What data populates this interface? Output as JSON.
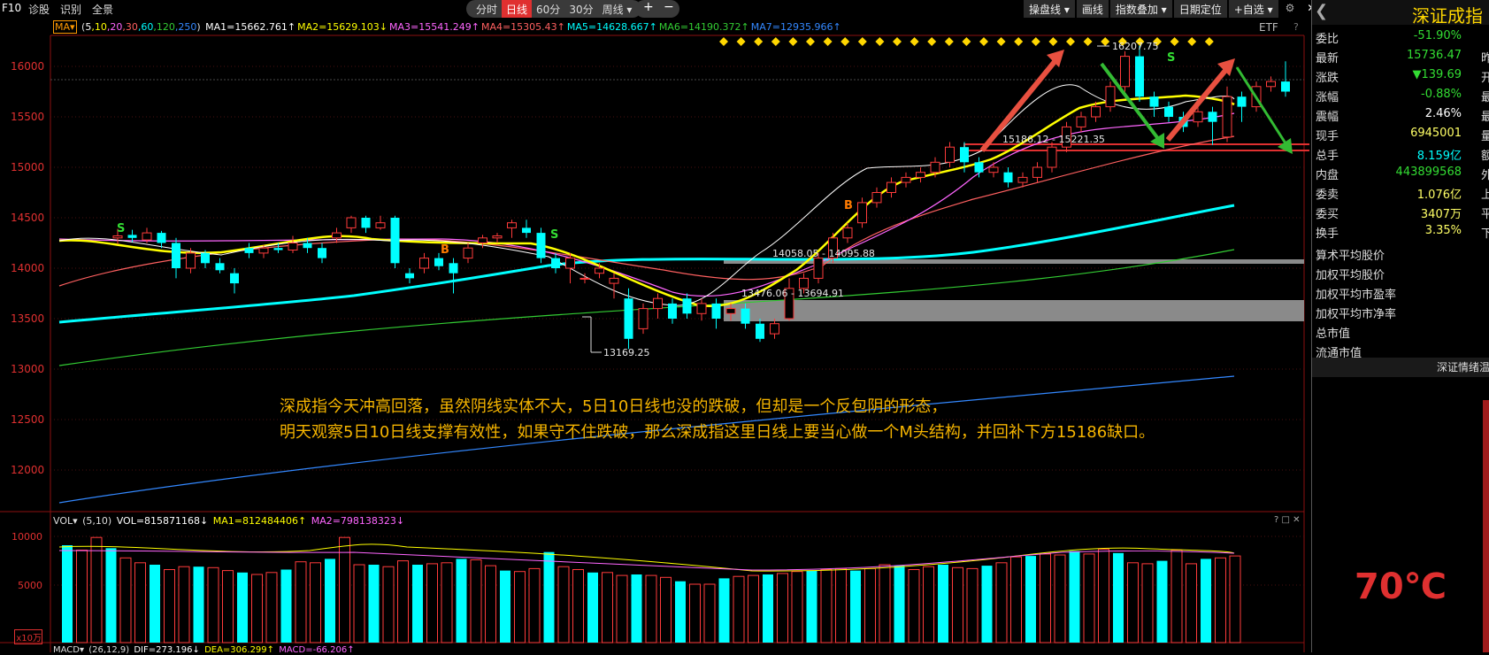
{
  "topbar": {
    "f10": "F10",
    "menu": [
      "诊股",
      "识别",
      "全景"
    ],
    "periods": [
      "分时",
      "日线",
      "60分",
      "30分",
      "周线 ▾"
    ],
    "active_period": "日线",
    "plus": "+",
    "minus": "−",
    "tools": [
      "操盘线 ▾",
      "画线",
      "指数叠加 ▾",
      "日期定位",
      "+自选 ▾"
    ],
    "gear": "⚙",
    "close": "✕"
  },
  "ma_header": {
    "selector": "MA▾",
    "params_open": "(",
    "params": [
      "5",
      ",10",
      ",20",
      ",30",
      ",60",
      ",120",
      ",250"
    ],
    "params_close": ")",
    "items": [
      {
        "text": "MA1=15662.761↑",
        "color": "#ffffff"
      },
      {
        "text": "MA2=15629.103↓",
        "color": "#ffff00"
      },
      {
        "text": "MA3=15541.249↑",
        "color": "#ff66ff"
      },
      {
        "text": "MA4=15305.43↑",
        "color": "#ff6060"
      },
      {
        "text": "MA5=14628.667↑",
        "color": "#00ffff"
      },
      {
        "text": "MA6=14190.372↑",
        "color": "#33cc33"
      },
      {
        "text": "MA7=12935.966↑",
        "color": "#3388ff"
      }
    ],
    "etf": "ETF",
    "help": "?"
  },
  "y_axis": [
    "16000",
    "15500",
    "15000",
    "14500",
    "14000",
    "13500",
    "13000",
    "12500",
    "12000"
  ],
  "level_labels": {
    "high": "16207.75",
    "gap1": "15186.12 - 15221.35",
    "gap2": "14058.05 - 14095.88",
    "gap3": "13476.06 - 13694.91",
    "low": "13169.25"
  },
  "signals": {
    "s": "S",
    "b": "B"
  },
  "annotation": {
    "line1": "深成指今天冲高回落，虽然阴线实体不大，5日10日线也没的跌破，但却是一个反包阴的形态，",
    "line2": "明天观察5日10日线支撑有效性，如果守不住跌破，那么深成指这里日线上要当心做一个M头结构，并回补下方15186缺口。"
  },
  "volume": {
    "label": "VOL▾",
    "params": "(5,10)",
    "vol": "VOL=815871168↓",
    "ma1": "MA1=812484406↑",
    "ma2": "MA2=798138323↓",
    "y_axis": [
      "10000",
      "5000"
    ],
    "unit": "x10万",
    "ctrl": "? □ ✕"
  },
  "macd": {
    "label": "MACD▾",
    "params": "(26,12,9)",
    "dif": "DIF=273.196↓",
    "dea": "DEA=306.299↑",
    "macd": "MACD=-66.206↑"
  },
  "right_panel": {
    "back": "❮",
    "title": "深证成指",
    "rows": [
      {
        "label": "委比",
        "value": "-51.90%",
        "color": "#33dd33",
        "suffix": ""
      },
      {
        "label": "最新",
        "value": "15736.47",
        "color": "#33dd33",
        "suffix": "昨"
      },
      {
        "label": "涨跌",
        "value": "▼139.69",
        "color": "#33dd33",
        "suffix": "开"
      },
      {
        "label": "涨幅",
        "value": "-0.88%",
        "color": "#33dd33",
        "suffix": "最"
      },
      {
        "label": "震幅",
        "value": "2.46%",
        "color": "#ffffff",
        "suffix": "最"
      },
      {
        "label": "现手",
        "value": "6945001",
        "color": "#ffff66",
        "suffix": "量"
      },
      {
        "label": "总手",
        "value": "8.159亿",
        "color": "#00ffff",
        "suffix": "额"
      },
      {
        "label": "内盘",
        "value": "443899568",
        "color": "#33dd33",
        "suffix": "外"
      },
      {
        "label": "委卖",
        "value": "1.076亿",
        "color": "#ffff66",
        "suffix": "上"
      },
      {
        "label": "委买",
        "value": "3407万",
        "color": "#ffff66",
        "suffix": "平"
      },
      {
        "label": "换手",
        "value": "3.35%",
        "color": "#ffff66",
        "suffix": "下"
      }
    ],
    "stats": [
      "算术平均股价",
      "加权平均股价",
      "加权平均市盈率",
      "加权平均市净率",
      "总市值",
      "流通市值"
    ],
    "tab": "深证情绪温",
    "temperature": "70℃"
  }
}
